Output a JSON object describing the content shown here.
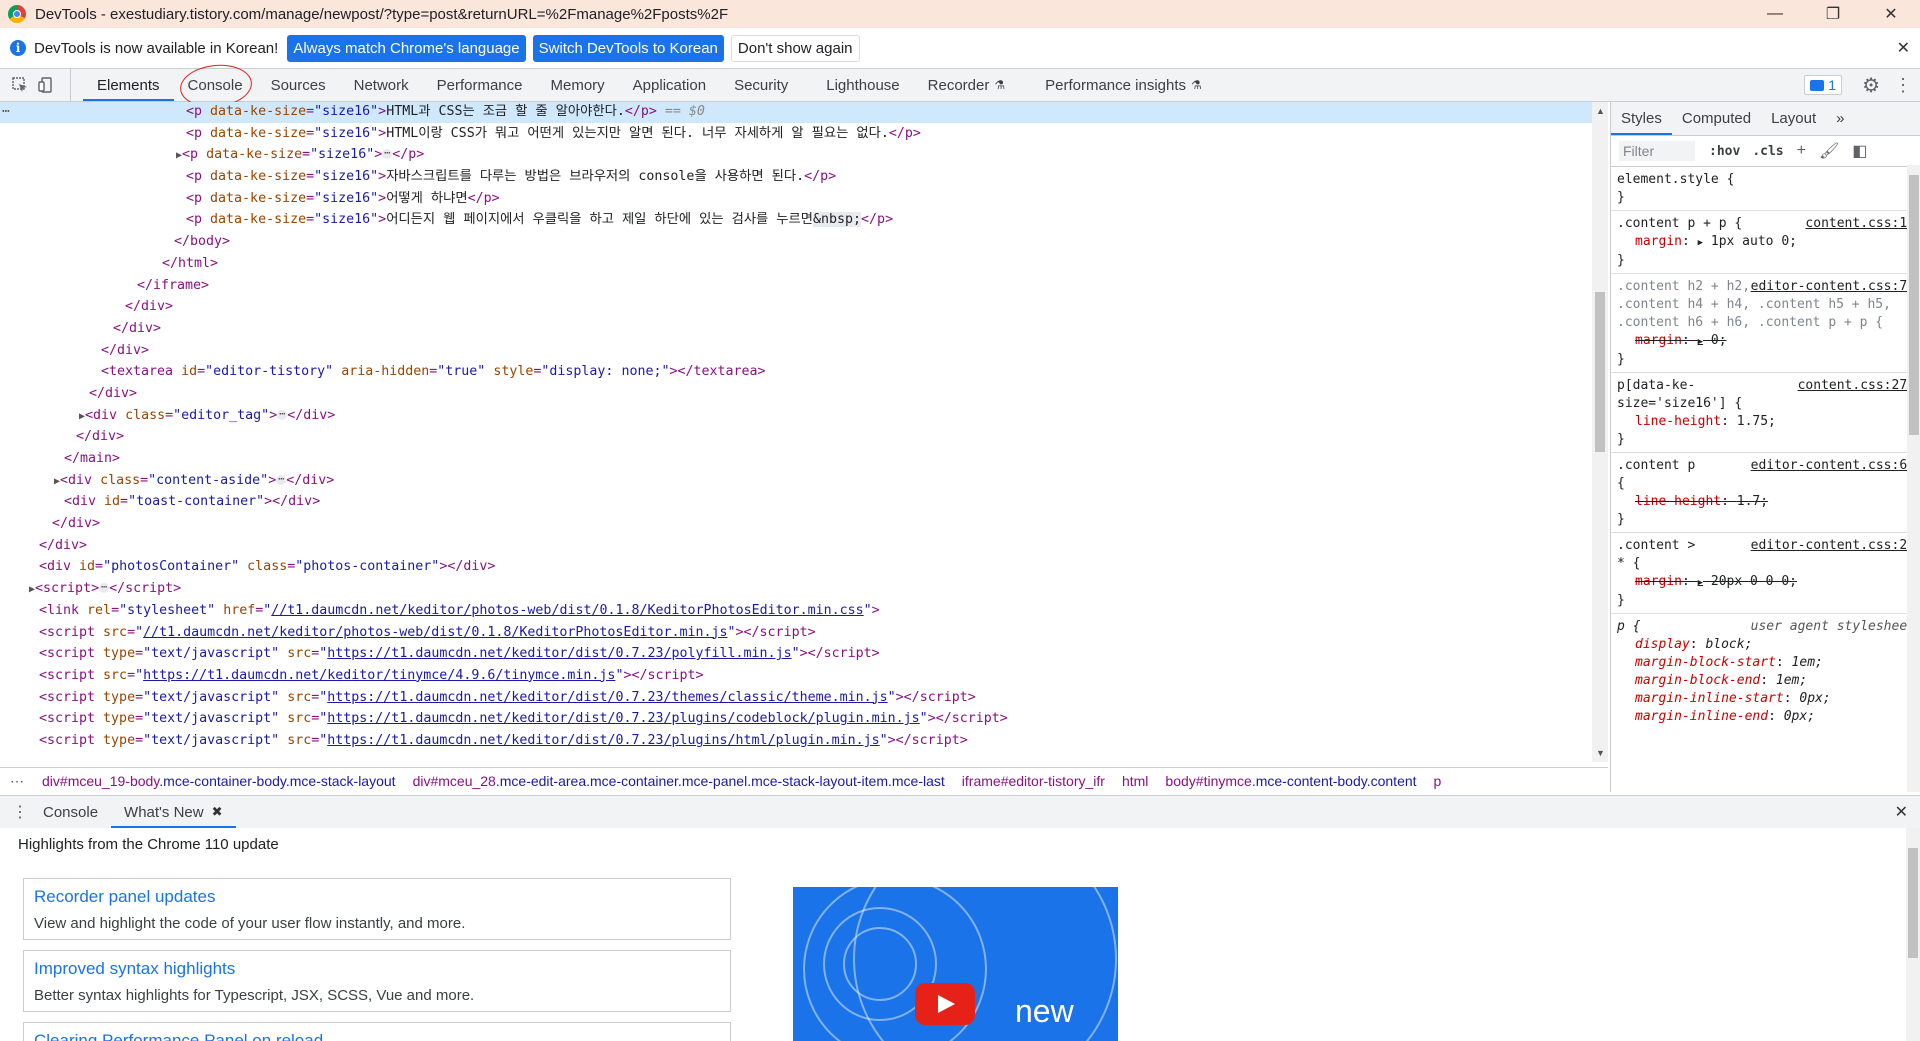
{
  "window": {
    "title": "DevTools - exestudiary.tistory.com/manage/newpost/?type=post&returnURL=%2Fmanage%2Fposts%2F",
    "minimize": "—",
    "maximize": "❐",
    "close": "✕"
  },
  "infobar": {
    "message": "DevTools is now available in Korean!",
    "btn_match": "Always match Chrome's language",
    "btn_switch": "Switch DevTools to Korean",
    "btn_dismiss": "Don't show again",
    "close": "✕"
  },
  "tabs": [
    "Elements",
    "Console",
    "Sources",
    "Network",
    "Performance",
    "Memory",
    "Application",
    "Security",
    "Lighthouse",
    "Recorder",
    "Performance insights"
  ],
  "issues_count": "1",
  "dom": {
    "l0": "    <p data-ke-size=\"size16\">",
    "l1_a": "HTML과 CSS는 조금 할 줄 알아야한다.",
    "l1_eq": " == $0",
    "l2_text": "HTML이랑 CSS가 뭐고 어떤게 있는지만 알면 된다. 너무 자세하게 알 필요는 없다.",
    "l4_text": "자바스크립트를 다루는 방법은 브라우저의 console을 사용하면 된다.",
    "l5_text": "어떻게 하냐면",
    "l6_text": "어디든지 웹 페이지에서 우클릭을 하고 제일 하단에 있는 검사를 누르면",
    "nbsp": "&nbsp;",
    "css_photos": "//t1.daumcdn.net/keditor/photos-web/dist/0.1.8/KeditorPhotosEditor.min.css",
    "js_photos": "//t1.daumcdn.net/keditor/photos-web/dist/0.1.8/KeditorPhotosEditor.min.js",
    "js_polyfill": "https://t1.daumcdn.net/keditor/dist/0.7.23/polyfill.min.js",
    "js_tinymce": "https://t1.daumcdn.net/keditor/tinymce/4.9.6/tinymce.min.js",
    "js_theme": "https://t1.daumcdn.net/keditor/dist/0.7.23/themes/classic/theme.min.js",
    "js_codeblock": "https://t1.daumcdn.net/keditor/dist/0.7.23/plugins/codeblock/plugin.min.js",
    "js_html": "https://t1.daumcdn.net/keditor/dist/0.7.23/plugins/html/plugin.min.js"
  },
  "breadcrumb": [
    {
      "tag": "div",
      "id": "#mceu_19-body",
      "cls": ".mce-container-body.mce-stack-layout"
    },
    {
      "tag": "div",
      "id": "#mceu_28",
      "cls": ".mce-edit-area.mce-container.mce-panel.mce-stack-layout-item.mce-last"
    },
    {
      "tag": "iframe",
      "id": "#editor-tistory_ifr",
      "cls": ""
    },
    {
      "tag": "html",
      "id": "",
      "cls": ""
    },
    {
      "tag": "body",
      "id": "#tinymce",
      "cls": ".mce-content-body.content"
    },
    {
      "tag": "p",
      "id": "",
      "cls": ""
    }
  ],
  "styles": {
    "tabs": [
      "Styles",
      "Computed",
      "Layout"
    ],
    "filter_placeholder": "Filter",
    "hov": ":hov",
    "cls": ".cls",
    "rules": {
      "r1_sel": "element.style {",
      "r2_sel": ".content p + p {",
      "r2_src": "content.css:16",
      "r2_prop": "margin",
      "r2_val": "1px auto 0;",
      "r3_src": "editor-content.css:75",
      "r3_sel": ".content h2 + h2, .content h3 + h3, .content h4 + h4, .content h5 + h5, .content h6 + h6, .content p + p {",
      "r3_prop": "margin",
      "r3_val": "0;",
      "r4_sel": "p[data-ke-size='size16'] {",
      "r4_src": "content.css:279",
      "r4_prop": "line-height",
      "r4_val": "1.75;",
      "r5_sel": ".content p {",
      "r5_src": "editor-content.css:66",
      "r5_prop": "line-height",
      "r5_val": "1.7;",
      "r6_sel": ".content > * {",
      "r6_src": "editor-content.css:27",
      "r6_prop": "margin",
      "r6_val": "20px 0 0 0;",
      "r7_sel": "p {",
      "r7_src": "user agent stylesheet",
      "r7_p1": "display",
      "r7_v1": "block;",
      "r7_p2": "margin-block-start",
      "r7_v2": "1em;",
      "r7_p3": "margin-block-end",
      "r7_v3": "1em;",
      "r7_p4": "margin-inline-start",
      "r7_v4": "0px;",
      "r7_p5": "margin-inline-end",
      "r7_v5": "0px;",
      "close": "}"
    }
  },
  "drawer": {
    "tab_console": "Console",
    "tab_whatsnew": "What's New",
    "highlights": "Highlights from the Chrome 110 update",
    "cards": [
      {
        "title": "Recorder panel updates",
        "desc": "View and highlight the code of your user flow instantly, and more."
      },
      {
        "title": "Improved syntax highlights",
        "desc": "Better syntax highlights for Typescript, JSX, SCSS, Vue and more."
      },
      {
        "title": "Clearing Performance Panel on reload",
        "desc": ""
      }
    ],
    "video_text": "new"
  },
  "colors": {
    "accent": "#1a73e8",
    "tag": "#881280",
    "attr": "#994500",
    "value": "#1a1aa6",
    "annotation": "#e02020"
  }
}
